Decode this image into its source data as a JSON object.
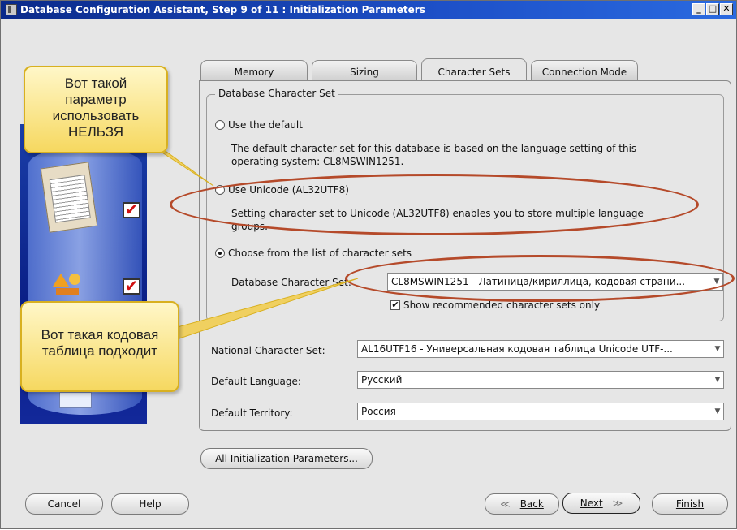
{
  "window": {
    "title": "Database Configuration Assistant, Step 9 of 11 : Initialization Parameters",
    "controls": [
      "_",
      "□",
      "✕"
    ]
  },
  "tabs": [
    {
      "label": "Memory",
      "active": false
    },
    {
      "label": "Sizing",
      "active": false
    },
    {
      "label": "Character Sets",
      "active": true
    },
    {
      "label": "Connection Mode",
      "active": false
    }
  ],
  "db_charset": {
    "legend": "Database Character Set",
    "option_default": {
      "label": "Use the default",
      "desc_line1": "The default character set for this database is based on the language setting of this",
      "desc_line2": "operating system: CL8MSWIN1251.",
      "checked": false
    },
    "option_unicode": {
      "label": "Use Unicode (AL32UTF8)",
      "desc_line1": "Setting character set to Unicode (AL32UTF8) enables you to store multiple language",
      "desc_line2": "groups.",
      "checked": false
    },
    "option_list": {
      "label": "Choose from the list of character sets",
      "checked": true
    },
    "charset_label": "Database Character Set:",
    "charset_value": "CL8MSWIN1251 - Латиница/кириллица, кодовая страни...",
    "recommended_label": "Show recommended character sets only",
    "recommended_checked": true
  },
  "national": {
    "label": "National Character Set:",
    "value": "AL16UTF16 - Универсальная кодовая таблица Unicode UTF-..."
  },
  "language": {
    "label": "Default Language:",
    "value": "Русский"
  },
  "territory": {
    "label": "Default Territory:",
    "value": "Россия"
  },
  "all_params_button": "All Initialization Parameters...",
  "footer": {
    "cancel": "Cancel",
    "help": "Help",
    "back_arrow": "≪",
    "back": "Back",
    "next": "Next",
    "next_arrow": "≫",
    "finish": "Finish"
  },
  "callouts": {
    "top_line1": "Вот такой",
    "top_line2": "параметр",
    "top_line3": "использовать",
    "top_line4": "НЕЛЬЗЯ",
    "bottom_line1": "Вот такая кодовая",
    "bottom_line2": "таблица подходит"
  },
  "colors": {
    "title_bar": "#0a2a8a",
    "annotation_ellipse": "#b54a2a",
    "callout_fill": "#f6d860"
  }
}
